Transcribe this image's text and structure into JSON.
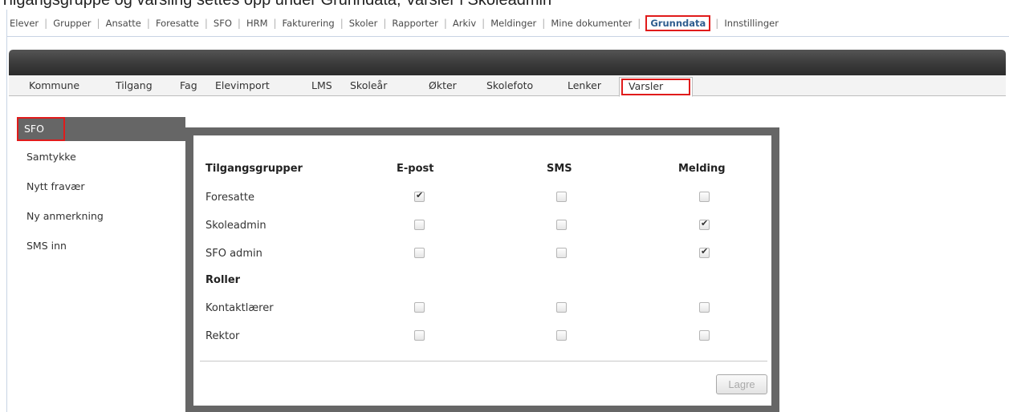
{
  "top_text": "Tilgangsgruppe og varsling settes opp under Grunndata, Varsler i Skoleadmin",
  "top_nav": {
    "items": [
      "Elever",
      "Grupper",
      "Ansatte",
      "Foresatte",
      "SFO",
      "HRM",
      "Fakturering",
      "Skoler",
      "Rapporter",
      "Arkiv",
      "Meldinger",
      "Mine dokumenter",
      "Grunndata",
      "Innstillinger"
    ],
    "active": "Grunndata"
  },
  "sub_nav": {
    "items": [
      "Kommune",
      "Tilgang",
      "Fag",
      "Elevimport",
      "LMS",
      "Skoleår",
      "Økter",
      "Skolefoto",
      "Lenker"
    ],
    "active": "Varsler"
  },
  "left_menu": {
    "header": "SFO",
    "items": [
      "Samtykke",
      "Nytt fravær",
      "Ny anmerkning",
      "SMS inn"
    ]
  },
  "panel": {
    "columns": [
      "Tilgangsgrupper",
      "E-post",
      "SMS",
      "Melding"
    ],
    "section_roles": "Roller",
    "rows": [
      {
        "label": "Foresatte",
        "email": true,
        "sms": false,
        "message": false
      },
      {
        "label": "Skoleadmin",
        "email": false,
        "sms": false,
        "message": true
      },
      {
        "label": "SFO admin",
        "email": false,
        "sms": false,
        "message": true
      },
      {
        "label": "Kontaktlærer",
        "email": false,
        "sms": false,
        "message": false
      },
      {
        "label": "Rektor",
        "email": false,
        "sms": false,
        "message": false
      }
    ],
    "save_label": "Lagre"
  },
  "colors": {
    "highlight_red": "#e01b1b",
    "active_link": "#2e5d8f",
    "panel_gray": "#666666"
  }
}
